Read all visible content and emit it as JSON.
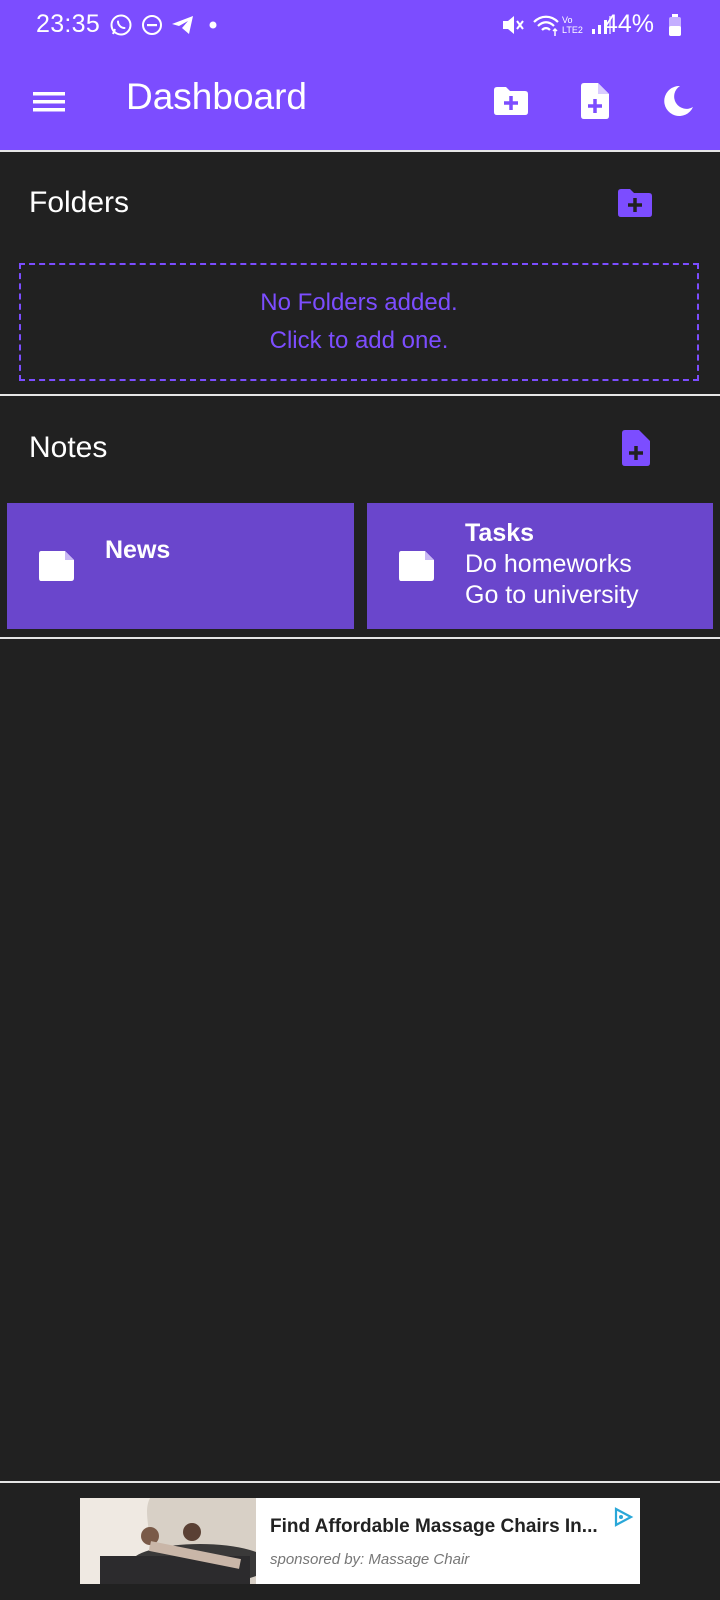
{
  "status_bar": {
    "time": "23:35",
    "network_label": "Vo LTE2",
    "battery": "44%",
    "icons": [
      "whatsapp-icon",
      "dnd-icon",
      "telegram-icon",
      "dot-icon",
      "mute-icon",
      "wifi-icon",
      "signal-icon",
      "battery-icon"
    ]
  },
  "app_bar": {
    "title": "Dashboard",
    "actions": [
      "add-folder-icon",
      "add-note-icon",
      "dark-mode-icon"
    ]
  },
  "colors": {
    "accent": "#7c4dff",
    "card": "#6a46cc",
    "background": "#212121"
  },
  "folders": {
    "title": "Folders",
    "empty_line1": "No Folders added.",
    "empty_line2": "Click to add one."
  },
  "notes": {
    "title": "Notes",
    "items": [
      {
        "title": "News"
      },
      {
        "title": "Tasks",
        "line1": "Do homeworks",
        "line2": "Go to university"
      }
    ]
  },
  "ad": {
    "headline": "Find Affordable Massage Chairs In...",
    "sponsor": "sponsored by: Massage Chair"
  }
}
